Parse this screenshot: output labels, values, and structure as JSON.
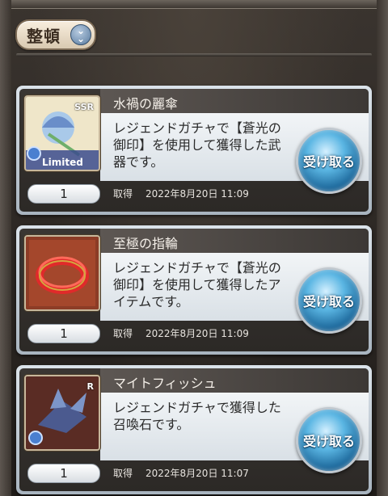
{
  "sort": {
    "label": "整頓",
    "icon": "chevron-down-icon"
  },
  "items": [
    {
      "name": "水禍の麗傘",
      "description": "レジェンドガチャで【蒼光の御印】を使用して獲得した武器です。",
      "quantity": "1",
      "acquired_label": "取得",
      "acquired_date": "2022年8月20日 11:09",
      "receive_label": "受け取る",
      "rarity": "SSR",
      "thumb_tag": "Limited",
      "thumb_icon": "umbrella-weapon-icon"
    },
    {
      "name": "至極の指輪",
      "description": "レジェンドガチャで【蒼光の御印】を使用して獲得したアイテムです。",
      "quantity": "1",
      "acquired_label": "取得",
      "acquired_date": "2022年8月20日 11:09",
      "receive_label": "受け取る",
      "thumb_icon": "ring-icon"
    },
    {
      "name": "マイトフィッシュ",
      "description": "レジェンドガチャで獲得した召喚石です。",
      "quantity": "1",
      "acquired_label": "取得",
      "acquired_date": "2022年8月20日 11:07",
      "receive_label": "受け取る",
      "rarity": "R",
      "thumb_icon": "fish-summon-icon"
    }
  ]
}
